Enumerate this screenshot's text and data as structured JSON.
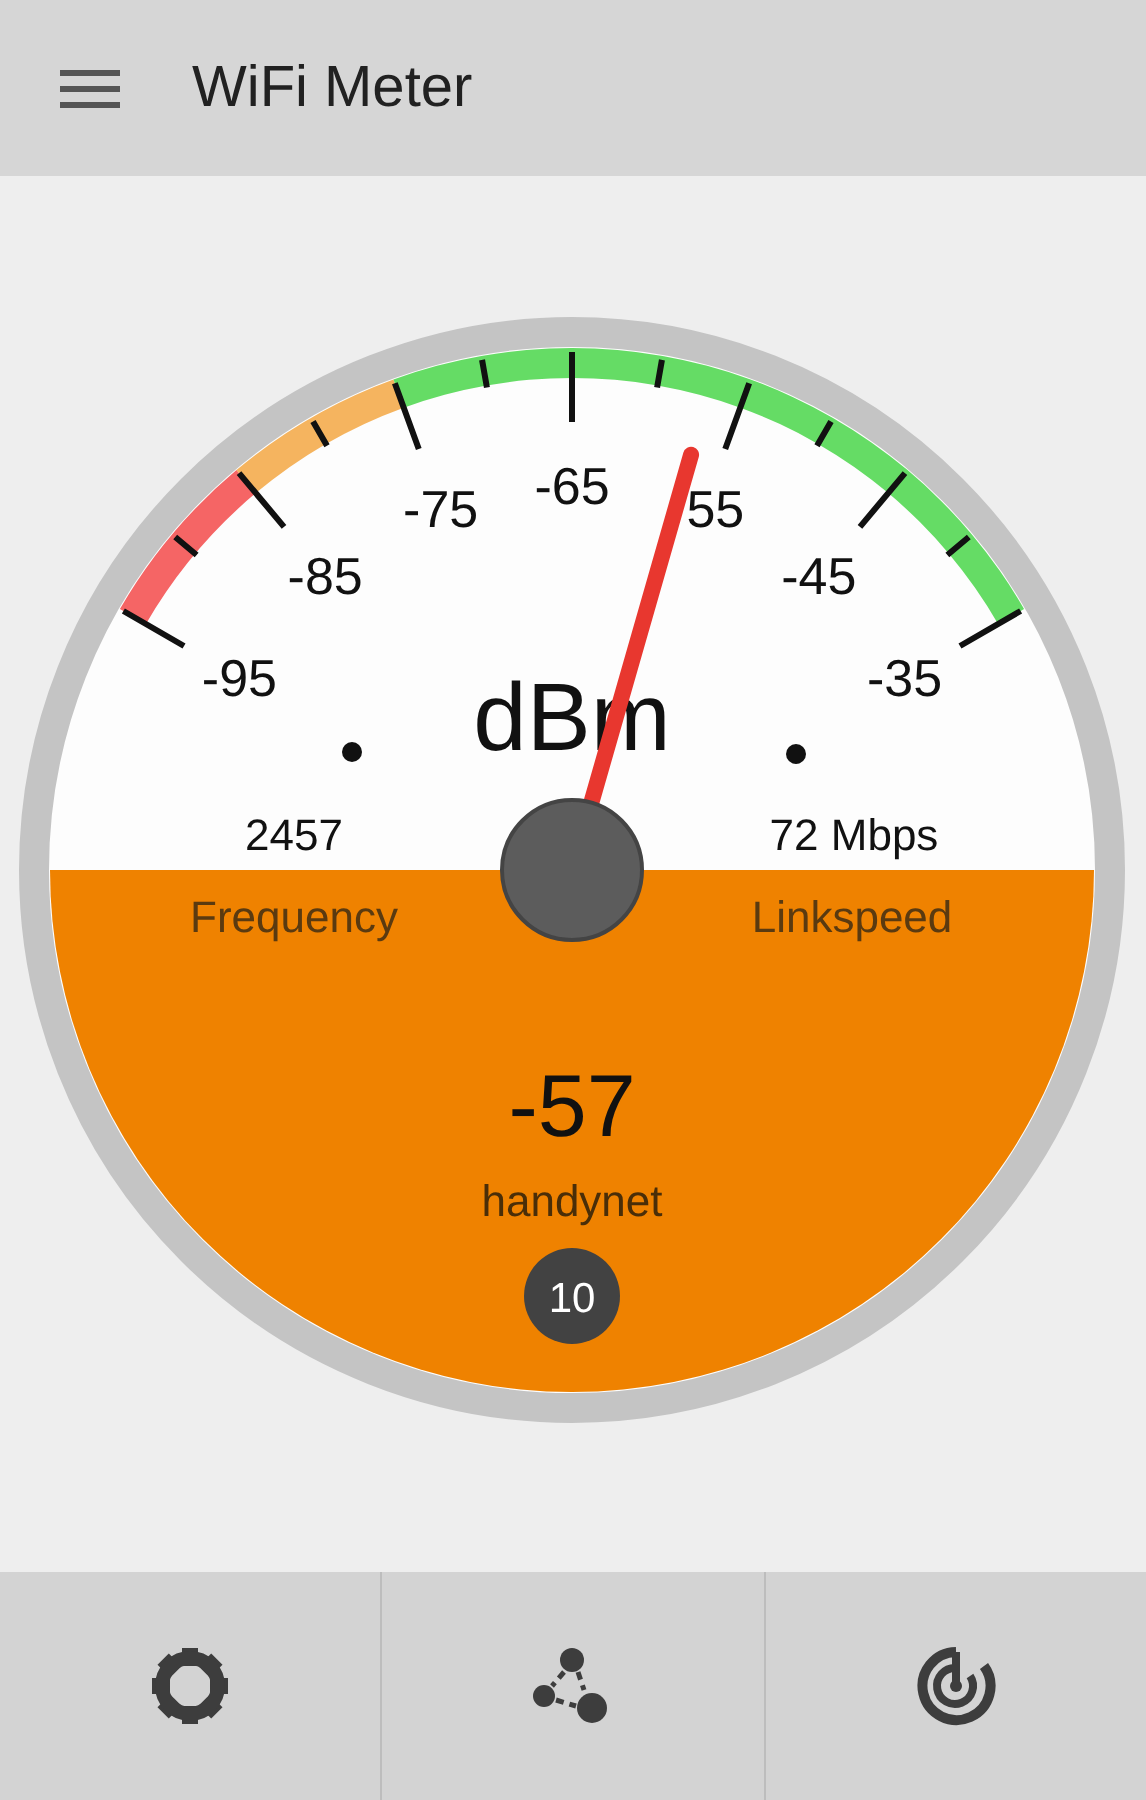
{
  "app_bar": {
    "title": "WiFi Meter"
  },
  "gauge": {
    "unit": "dBm",
    "scale_labels": [
      "-95",
      "-85",
      "-75",
      "-65",
      "55",
      "-45",
      "-35"
    ],
    "frequency": {
      "value": "2457",
      "label": "Frequency"
    },
    "linkspeed": {
      "value": "72 Mbps",
      "label": "Linkspeed"
    },
    "signal": "-57",
    "network": "handynet",
    "channel": "10"
  },
  "bottom_bar": {
    "buttons": [
      {
        "kind": "settings"
      },
      {
        "kind": "network"
      },
      {
        "kind": "radar"
      }
    ]
  }
}
